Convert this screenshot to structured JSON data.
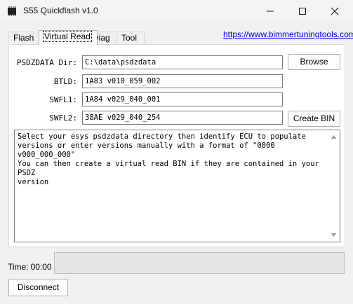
{
  "window": {
    "title": "S55 Quickflash v1.0",
    "icons": {
      "app": "chip-icon",
      "minimize": "minimize-icon",
      "maximize": "maximize-icon",
      "close": "close-icon"
    }
  },
  "tabs": [
    {
      "label": "Flash",
      "active": false
    },
    {
      "label": "Virtual Read",
      "active": true
    },
    {
      "label": "Diag",
      "active": false
    },
    {
      "label": "Tool",
      "active": false
    }
  ],
  "link": "https://www.bimmertuningtools.com",
  "form": {
    "psdzdata_label": "PSDZDATA Dir:",
    "psdzdata_value": "C:\\data\\psdzdata",
    "btld_label": "BTLD:",
    "btld_value": "1A83 v010_059_002",
    "swfl1_label": "SWFL1:",
    "swfl1_value": "1A84 v029_040_001",
    "swfl2_label": "SWFL2:",
    "swfl2_value": "38AE v029_040_254",
    "browse_label": "Browse",
    "create_bin_label": "Create BIN"
  },
  "log_text": "Select your esys psdzdata directory then identify ECU to populate\nversions or enter versions manually with a format of \"0000 v000_000_000\"\nYou can then create a virtual read BIN if they are contained in your PSDZ\nversion",
  "status": {
    "time_label": "Time:",
    "time_value": "00:00",
    "progress": 0
  },
  "disconnect_label": "Disconnect"
}
